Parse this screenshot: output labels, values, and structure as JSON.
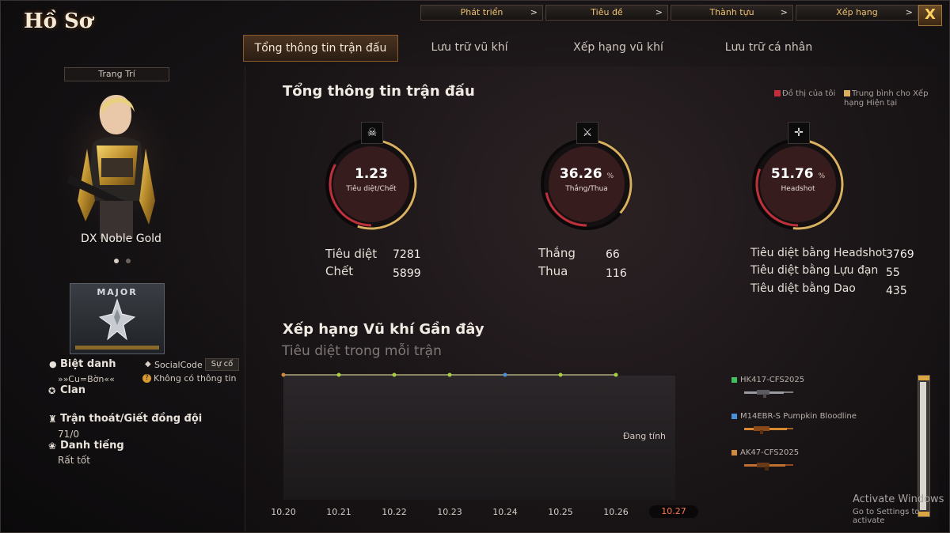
{
  "window": {
    "title": "Hồ Sơ",
    "close_label": "X"
  },
  "topnav": [
    {
      "label": "Phát triển",
      "chevron": ">"
    },
    {
      "label": "Tiêu đề",
      "chevron": ">"
    },
    {
      "label": "Thành tựu",
      "chevron": ">"
    },
    {
      "label": "Xếp hạng",
      "chevron": ">"
    }
  ],
  "tabs": [
    {
      "label": "Tổng thông tin trận đấu",
      "active": true
    },
    {
      "label": "Lưu trữ vũ khí",
      "active": false
    },
    {
      "label": "Xếp hạng vũ khí",
      "active": false
    },
    {
      "label": "Lưu trữ cá nhân",
      "active": false
    }
  ],
  "profile": {
    "decor_label": "Trang Trí",
    "character_name": "DX Noble Gold",
    "carousel_dots": 2,
    "carousel_active": 0,
    "rank_name": "MAJOR",
    "nickname_label": "Biệt danh",
    "nickname_value": "»»Cu=Bờn««",
    "socialcode_label": "SocialCode",
    "socialcode_button": "Sự cố",
    "socialcode_value": "Không có thông tin",
    "clan_label": "Clan",
    "escape_label": "Trận thoát/Giết đồng đội",
    "escape_value": "71/0",
    "reputation_label": "Danh tiếng",
    "reputation_value": "Rất tốt"
  },
  "summary": {
    "title": "Tổng thông tin trận đấu",
    "legend_mine": "Đồ thị của tôi",
    "legend_avg": "Trung bình cho Xếp hạng Hiện tại",
    "legend_colors": {
      "mine": "#c0303a",
      "avg": "#d8b060"
    },
    "gauges": [
      {
        "value": "1.23",
        "unit": "",
        "label": "Tiêu diệt/Chết",
        "icon": "skull-crossbones-icon",
        "glyph": "☠",
        "fill": 0.55
      },
      {
        "value": "36.26",
        "unit": "%",
        "label": "Thắng/Thua",
        "icon": "crossed-swords-icon",
        "glyph": "⚔",
        "fill": 0.3626
      },
      {
        "value": "51.76",
        "unit": "%",
        "label": "Headshot",
        "icon": "sniper-rifle-icon",
        "glyph": "✛",
        "fill": 0.5176
      }
    ],
    "stats_kd": [
      {
        "label": "Tiêu diệt",
        "value": "7281"
      },
      {
        "label": "Chết",
        "value": "5899"
      }
    ],
    "stats_wl": [
      {
        "label": "Thắng",
        "value": "66"
      },
      {
        "label": "Thua",
        "value": "116"
      }
    ],
    "stats_kills": [
      {
        "label": "Tiêu diệt bằng Headshot",
        "value": "3769"
      },
      {
        "label": "Tiêu diệt bằng Lựu đạn",
        "value": "55"
      },
      {
        "label": "Tiêu diệt bằng Dao",
        "value": "435"
      }
    ]
  },
  "recent": {
    "title": "Xếp hạng Vũ khí Gần đây",
    "subtitle": "Tiêu diệt trong mỗi trận",
    "status": "Đang tính",
    "weapons": [
      {
        "name": "HK417-CFS2025",
        "color": "#40c060"
      },
      {
        "name": "M14EBR-S Pumpkin Bloodline",
        "color": "#4a90d8"
      },
      {
        "name": "AK47-CFS2025",
        "color": "#d08a40"
      }
    ]
  },
  "chart_data": {
    "type": "line",
    "title": "Tiêu diệt trong mỗi trận",
    "xlabel": "",
    "ylabel": "",
    "categories": [
      "10.20",
      "10.21",
      "10.22",
      "10.23",
      "10.24",
      "10.25",
      "10.26",
      "10.27"
    ],
    "selected_category": "10.27",
    "series": [
      {
        "name": "HK417-CFS2025",
        "color": "#40c060",
        "values": [
          0,
          0,
          0,
          0,
          0,
          0,
          0,
          null
        ]
      },
      {
        "name": "M14EBR-S Pumpkin Bloodline",
        "color": "#4a90d8",
        "values": [
          0,
          0,
          0,
          0,
          0,
          0,
          0,
          null
        ]
      },
      {
        "name": "AK47-CFS2025",
        "color": "#d08a40",
        "values": [
          0,
          0,
          0,
          0,
          0,
          0,
          0,
          null
        ]
      }
    ],
    "grid": false
  },
  "watermark": {
    "line1": "Activate Windows",
    "line2": "Go to Settings to activate"
  }
}
